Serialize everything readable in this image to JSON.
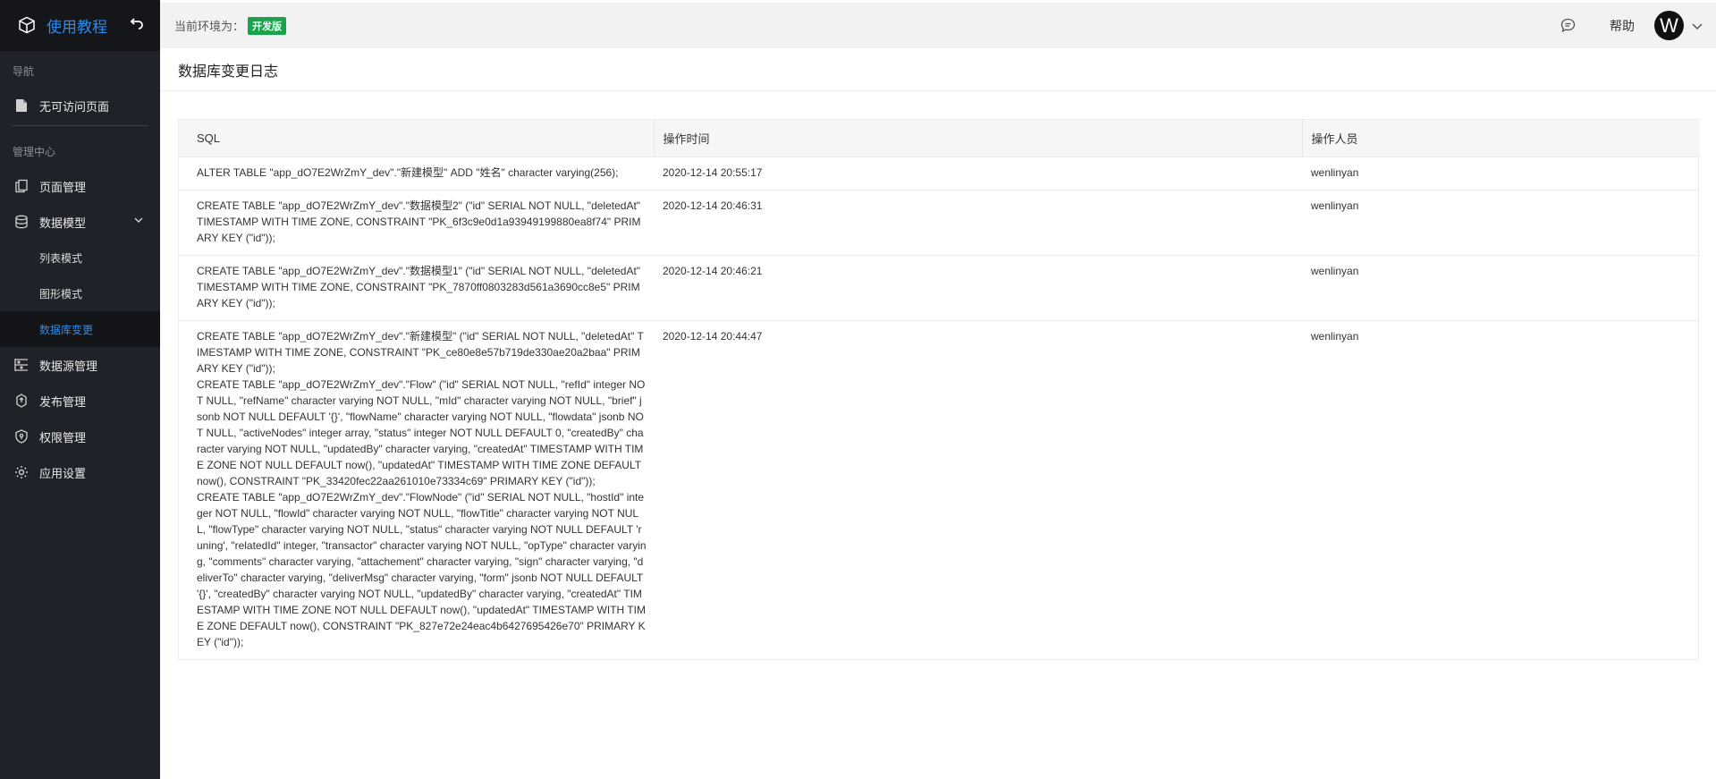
{
  "app": {
    "title": "使用教程",
    "back_icon": "undo-icon",
    "logo_icon": "cube-icon"
  },
  "sidebar": {
    "groups": [
      {
        "title": "导航"
      },
      {
        "title": "管理中心"
      }
    ],
    "nav_item": {
      "label": "无可访问页面",
      "icon": "file-icon"
    },
    "items": [
      {
        "label": "页面管理",
        "icon": "pages-icon"
      },
      {
        "label": "数据模型",
        "icon": "database-icon",
        "expanded": true
      },
      {
        "label": "数据源管理",
        "icon": "list-settings-icon"
      },
      {
        "label": "发布管理",
        "icon": "publish-icon"
      },
      {
        "label": "权限管理",
        "icon": "shield-icon"
      },
      {
        "label": "应用设置",
        "icon": "gear-icon"
      }
    ],
    "sub_items": [
      {
        "label": "列表模式"
      },
      {
        "label": "图形模式"
      },
      {
        "label": "数据库变更",
        "active": true
      }
    ]
  },
  "header": {
    "env_label": "当前环境为：",
    "env_badge": "开发版",
    "help": "帮助",
    "avatar": "W"
  },
  "page": {
    "title": "数据库变更日志"
  },
  "table": {
    "columns": [
      "SQL",
      "操作时间",
      "操作人员"
    ],
    "rows": [
      {
        "sql": "ALTER TABLE \"app_dO7E2WrZmY_dev\".\"新建模型\" ADD \"姓名\" character varying(256);",
        "time": "2020-12-14 20:55:17",
        "user": "wenlinyan"
      },
      {
        "sql": "CREATE TABLE \"app_dO7E2WrZmY_dev\".\"数据模型2\" (\"id\" SERIAL NOT NULL, \"deletedAt\" TIMESTAMP WITH TIME ZONE, CONSTRAINT \"PK_6f3c9e0d1a93949199880ea8f74\" PRIMARY KEY (\"id\"));",
        "time": "2020-12-14 20:46:31",
        "user": "wenlinyan"
      },
      {
        "sql": "CREATE TABLE \"app_dO7E2WrZmY_dev\".\"数据模型1\" (\"id\" SERIAL NOT NULL, \"deletedAt\" TIMESTAMP WITH TIME ZONE, CONSTRAINT \"PK_7870ff0803283d561a3690cc8e5\" PRIMARY KEY (\"id\"));",
        "time": "2020-12-14 20:46:21",
        "user": "wenlinyan"
      },
      {
        "sql": "CREATE TABLE \"app_dO7E2WrZmY_dev\".\"新建模型\" (\"id\" SERIAL NOT NULL, \"deletedAt\" TIMESTAMP WITH TIME ZONE, CONSTRAINT \"PK_ce80e8e57b719de330ae20a2baa\" PRIMARY KEY (\"id\"));\nCREATE TABLE \"app_dO7E2WrZmY_dev\".\"Flow\" (\"id\" SERIAL NOT NULL, \"refId\" integer NOT NULL, \"refName\" character varying NOT NULL, \"mId\" character varying NOT NULL, \"brief\" jsonb NOT NULL DEFAULT '{}', \"flowName\" character varying NOT NULL, \"flowdata\" jsonb NOT NULL, \"activeNodes\" integer array, \"status\" integer NOT NULL DEFAULT 0, \"createdBy\" character varying NOT NULL, \"updatedBy\" character varying, \"createdAt\" TIMESTAMP WITH TIME ZONE NOT NULL DEFAULT now(), \"updatedAt\" TIMESTAMP WITH TIME ZONE DEFAULT now(), CONSTRAINT \"PK_33420fec22aa261010e73334c69\" PRIMARY KEY (\"id\"));\nCREATE TABLE \"app_dO7E2WrZmY_dev\".\"FlowNode\" (\"id\" SERIAL NOT NULL, \"hostId\" integer NOT NULL, \"flowId\" character varying NOT NULL, \"flowTitle\" character varying NOT NULL, \"flowType\" character varying NOT NULL, \"status\" character varying NOT NULL DEFAULT 'runing', \"relatedId\" integer, \"transactor\" character varying NOT NULL, \"opType\" character varying, \"comments\" character varying, \"attachement\" character varying, \"sign\" character varying, \"deliverTo\" character varying, \"deliverMsg\" character varying, \"form\" jsonb NOT NULL DEFAULT '{}', \"createdBy\" character varying NOT NULL, \"updatedBy\" character varying, \"createdAt\" TIMESTAMP WITH TIME ZONE NOT NULL DEFAULT now(), \"updatedAt\" TIMESTAMP WITH TIME ZONE DEFAULT now(), CONSTRAINT \"PK_827e72e24eac4b6427695426e70\" PRIMARY KEY (\"id\"));",
        "time": "2020-12-14 20:44:47",
        "user": "wenlinyan"
      }
    ]
  },
  "colors": {
    "accent": "#2b8cf0",
    "sidebar_bg": "#1f2329",
    "env_badge": "#19a34a"
  }
}
